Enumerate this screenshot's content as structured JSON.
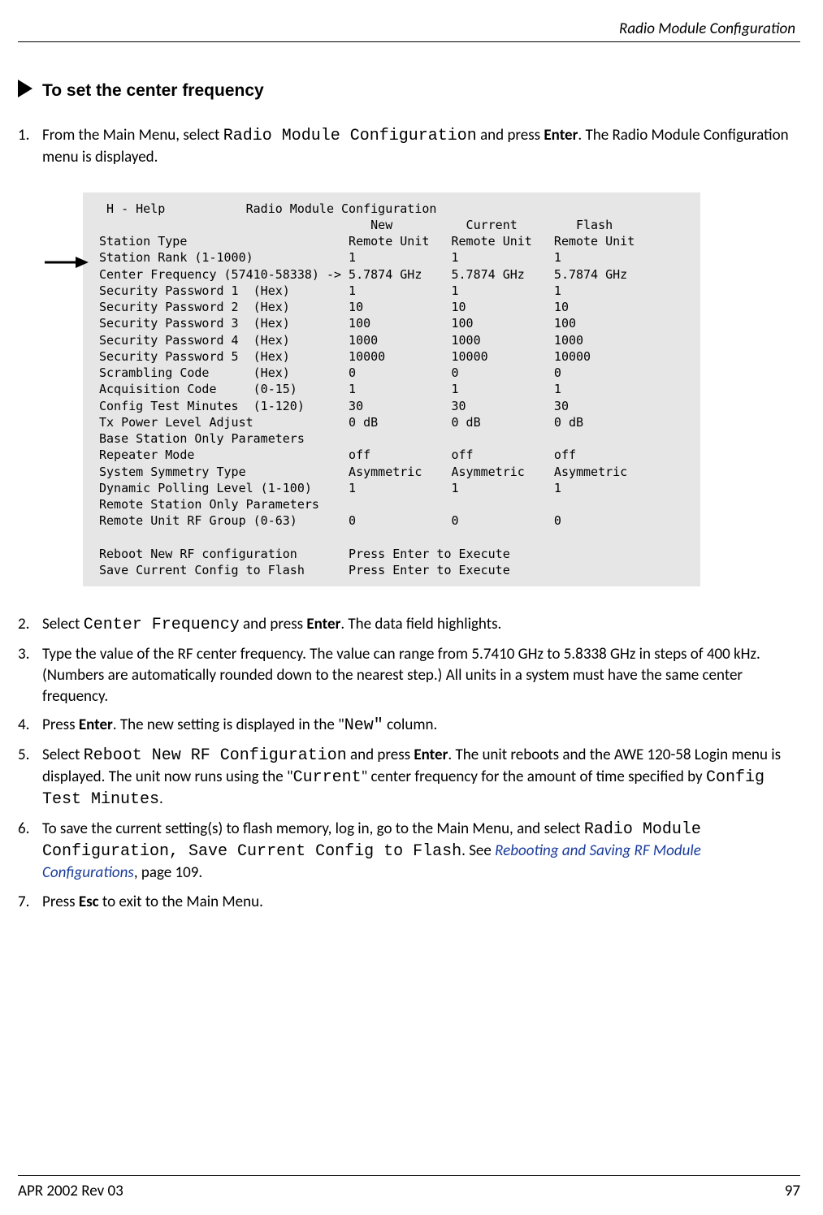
{
  "running_head": "Radio Module Configuration",
  "proc_title": "To set the center frequency",
  "steps": {
    "s1": {
      "num": "1.",
      "pre": "From the Main Menu, select ",
      "code1": "Radio Module Configuration",
      "mid": " and press ",
      "bold1": "Enter",
      "post": ". The Radio Module Configuration menu is displayed."
    },
    "s2": {
      "num": "2.",
      "pre": "Select ",
      "code1": "Center Frequency",
      "mid": " and press ",
      "bold1": "Enter",
      "post": ". The data field highlights."
    },
    "s3": {
      "num": "3.",
      "text": "Type the value of the RF center frequency. The value can range from 5.7410 GHz to 5.8338 GHz in steps of 400 kHz. (Numbers are automatically rounded down to the nearest step.) All units in a system must have the same center frequency."
    },
    "s4": {
      "num": "4.",
      "pre": "Press ",
      "bold1": "Enter",
      "mid": ". The new setting is displayed in the \"",
      "code1": "New\"",
      "post": " column."
    },
    "s5": {
      "num": "5.",
      "pre": "Select ",
      "code1": "Reboot New RF Configuration",
      "mid": " and press ",
      "bold1": "Enter",
      "mid2": ". The unit reboots and the AWE 120-58 Login menu is displayed. The unit now runs using the \"",
      "code2": "Current",
      "mid3": "\" center frequency for the amount of time specified by ",
      "code3": "Config Test Minutes",
      "post": "."
    },
    "s6": {
      "num": "6.",
      "pre": "To save the current setting(s) to flash memory, log in, go to the Main Menu, and select ",
      "code1": "Radio Module Configuration",
      "comma": ", ",
      "code2": "Save Current Config to Flash",
      "mid": ". See ",
      "link": "Rebooting and Saving RF Module Configurations",
      "post": ", page 109."
    },
    "s7": {
      "num": "7.",
      "pre": "Press ",
      "bold1": "Esc",
      "post": " to exit to the Main Menu."
    }
  },
  "screen": {
    "title_col": " H - Help           Radio Module Configuration",
    "hdr": "                                     New          Current        Flash",
    "rows": [
      "Station Type                      Remote Unit   Remote Unit   Remote Unit",
      "Station Rank (1-1000)             1             1             1",
      "Center Frequency (57410-58338) -> 5.7874 GHz    5.7874 GHz    5.7874 GHz",
      "Security Password 1  (Hex)        1             1             1",
      "Security Password 2  (Hex)        10            10            10",
      "Security Password 3  (Hex)        100           100           100",
      "Security Password 4  (Hex)        1000          1000          1000",
      "Security Password 5  (Hex)        10000         10000         10000",
      "Scrambling Code      (Hex)        0             0             0",
      "Acquisition Code     (0-15)       1             1             1",
      "Config Test Minutes  (1-120)      30            30            30",
      "Tx Power Level Adjust             0 dB          0 dB          0 dB",
      "Base Station Only Parameters",
      "Repeater Mode                     off           off           off",
      "System Symmetry Type              Asymmetric    Asymmetric    Asymmetric",
      "Dynamic Polling Level (1-100)     1             1             1",
      "Remote Station Only Parameters",
      "Remote Unit RF Group (0-63)       0             0             0",
      "",
      "Reboot New RF configuration       Press Enter to Execute",
      "Save Current Config to Flash      Press Enter to Execute"
    ]
  },
  "footer": {
    "left": "APR 2002 Rev 03",
    "right": "97"
  }
}
